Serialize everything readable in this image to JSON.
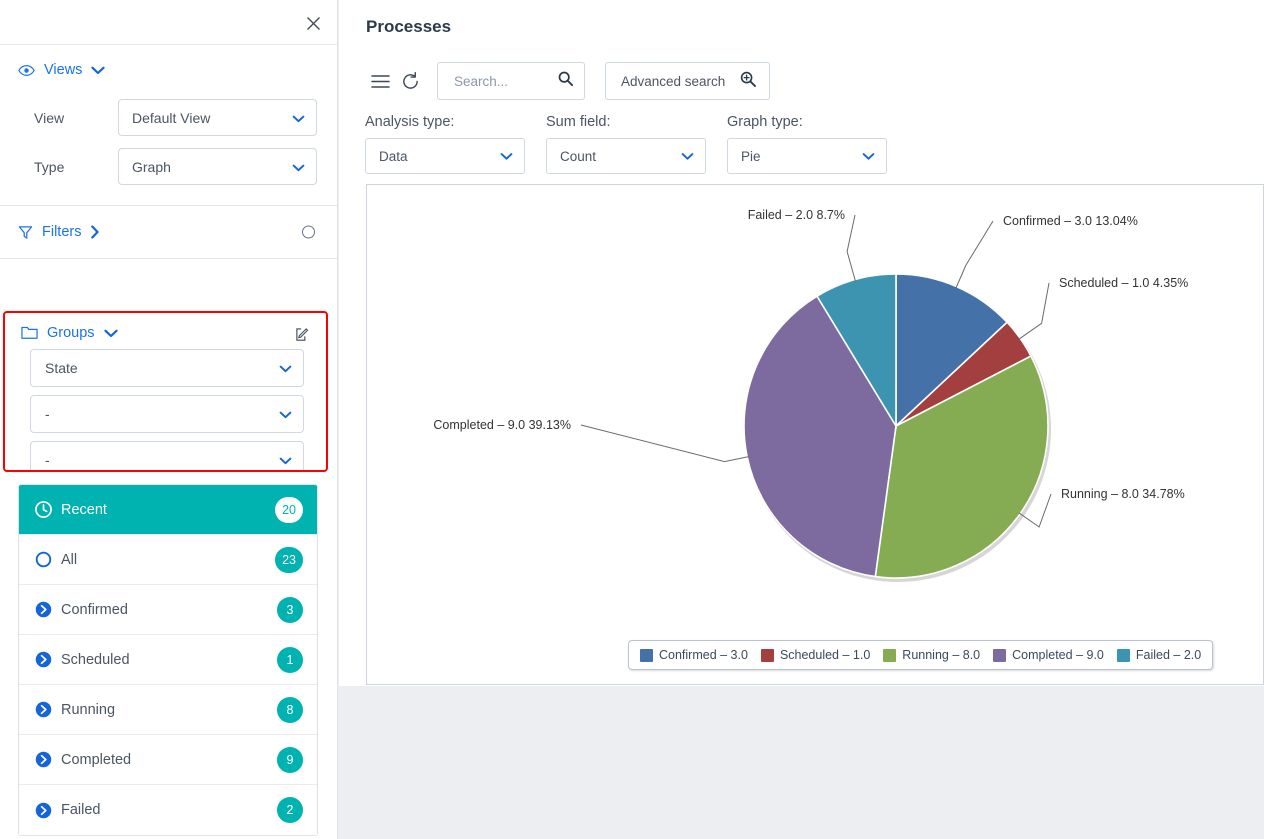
{
  "left_panel": {
    "close_icon": "close-icon",
    "views": {
      "icon": "eye-icon",
      "title": "Views",
      "chevron": "chevron-down-icon",
      "fields": [
        {
          "label": "View",
          "value": "Default View"
        },
        {
          "label": "Type",
          "value": "Graph"
        }
      ]
    },
    "filters": {
      "icon": "funnel-icon",
      "title": "Filters",
      "chevron": "chevron-right-icon",
      "status_circle": "circle-icon"
    },
    "groups": {
      "icon": "folder-icon",
      "title": "Groups",
      "chevron": "chevron-down-icon",
      "edit_icon": "edit-icon",
      "highlight_color": "#ff0000",
      "selects": [
        {
          "value": "State"
        },
        {
          "value": "-"
        },
        {
          "value": "-"
        }
      ]
    },
    "status_list": [
      {
        "label": "Recent",
        "count": "20",
        "icon": "clock-icon",
        "active": true
      },
      {
        "label": "All",
        "count": "23",
        "icon": "circle-outline-icon",
        "active": false
      },
      {
        "label": "Confirmed",
        "count": "3",
        "icon": "arrow-circle-right-icon",
        "active": false
      },
      {
        "label": "Scheduled",
        "count": "1",
        "icon": "arrow-circle-right-icon",
        "active": false
      },
      {
        "label": "Running",
        "count": "8",
        "icon": "arrow-circle-right-icon",
        "active": false
      },
      {
        "label": "Completed",
        "count": "9",
        "icon": "arrow-circle-right-icon",
        "active": false
      },
      {
        "label": "Failed",
        "count": "2",
        "icon": "arrow-circle-right-icon",
        "active": false
      }
    ]
  },
  "main": {
    "title": "Processes",
    "toolbar": {
      "menu_icon": "hamburger-menu-icon",
      "refresh_icon": "refresh-icon",
      "search_placeholder": "Search...",
      "search_value": "",
      "search_icon": "search-icon",
      "advanced_search_label": "Advanced search",
      "advanced_search_icon": "zoom-in-icon"
    },
    "selectors": [
      {
        "label": "Analysis type:",
        "value": "Data"
      },
      {
        "label": "Sum field:",
        "value": "Count"
      },
      {
        "label": "Graph type:",
        "value": "Pie"
      }
    ]
  },
  "chart_data": {
    "type": "pie",
    "title": "",
    "total": 23,
    "legend_position": "bottom",
    "categories": [
      "Confirmed",
      "Scheduled",
      "Running",
      "Completed",
      "Failed"
    ],
    "values": [
      3.0,
      1.0,
      8.0,
      9.0,
      2.0
    ],
    "percents": [
      13.04,
      4.35,
      34.78,
      39.13,
      8.7
    ],
    "colors": [
      "#4472a8",
      "#a33f3f",
      "#86ac53",
      "#7d6a9e",
      "#3d94b0"
    ],
    "slice_labels": [
      "Confirmed – 3.0 13.04%",
      "Scheduled – 1.0 4.35%",
      "Running – 8.0 34.78%",
      "Completed – 9.0 39.13%",
      "Failed – 2.0 8.7%"
    ],
    "legend_labels": [
      "Confirmed – 3.0",
      "Scheduled – 1.0",
      "Running – 8.0",
      "Completed – 9.0",
      "Failed – 2.0"
    ]
  }
}
